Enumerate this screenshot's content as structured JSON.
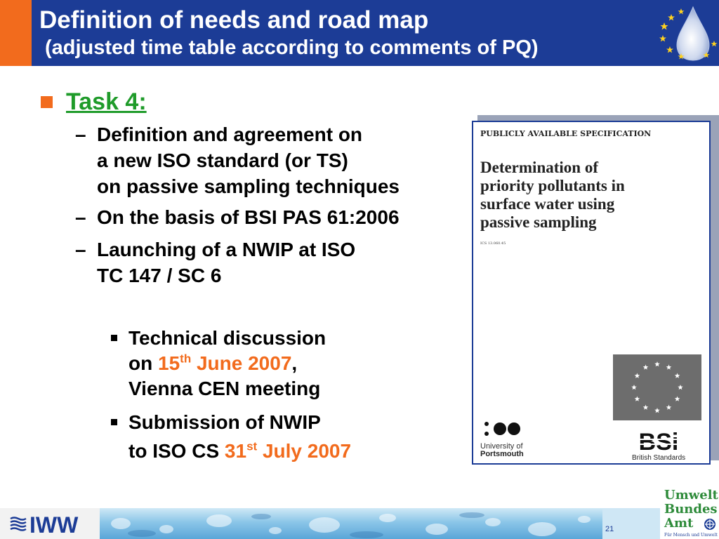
{
  "header": {
    "title": "Definition of needs and road map",
    "subtitle": "(adjusted time table according to comments of PQ)"
  },
  "content": {
    "task_label": "Task 4:",
    "bullets": [
      {
        "lines": [
          "Definition and agreement on",
          "a new ISO standard (or TS)",
          "on passive sampling techniques"
        ]
      },
      {
        "lines": [
          "On the basis of BSI PAS 61:2006"
        ]
      },
      {
        "lines": [
          "Launching of a NWIP at ISO",
          "TC 147 / SC 6"
        ]
      }
    ],
    "sub_bullets": {
      "first": {
        "line1": "Technical discussion",
        "line2_prefix": "on ",
        "line2_date_num": "15",
        "line2_date_sup": "th",
        "line2_date_rest": " June 2007",
        "line2_suffix": ",",
        "line3": "Vienna CEN meeting"
      },
      "second": {
        "line1": "Submission of NWIP",
        "line2_prefix": "to ISO CS ",
        "line2_date_num": "31",
        "line2_date_sup": "st",
        "line2_date_rest": " July 2007"
      }
    }
  },
  "document_cover": {
    "spec_label": "PUBLICLY AVAILABLE SPECIFICATION",
    "title_lines": [
      "Determination of",
      "priority pollutants in",
      "surface water using",
      "passive sampling"
    ],
    "ics": "ICS 13.060.45",
    "university_line1": "University of",
    "university_line2": "Portsmouth",
    "bsi_text": "BSi",
    "bsi_sub": "British Standards"
  },
  "footer": {
    "iww": "IWW",
    "page_number": "21",
    "uba_lines": [
      "Umwelt",
      "Bundes",
      "Amt"
    ],
    "uba_small": "Für Mensch und Umwelt"
  },
  "colors": {
    "header_blue": "#1c3c96",
    "accent_orange": "#f26b1d",
    "task_green": "#1f9b2a"
  }
}
